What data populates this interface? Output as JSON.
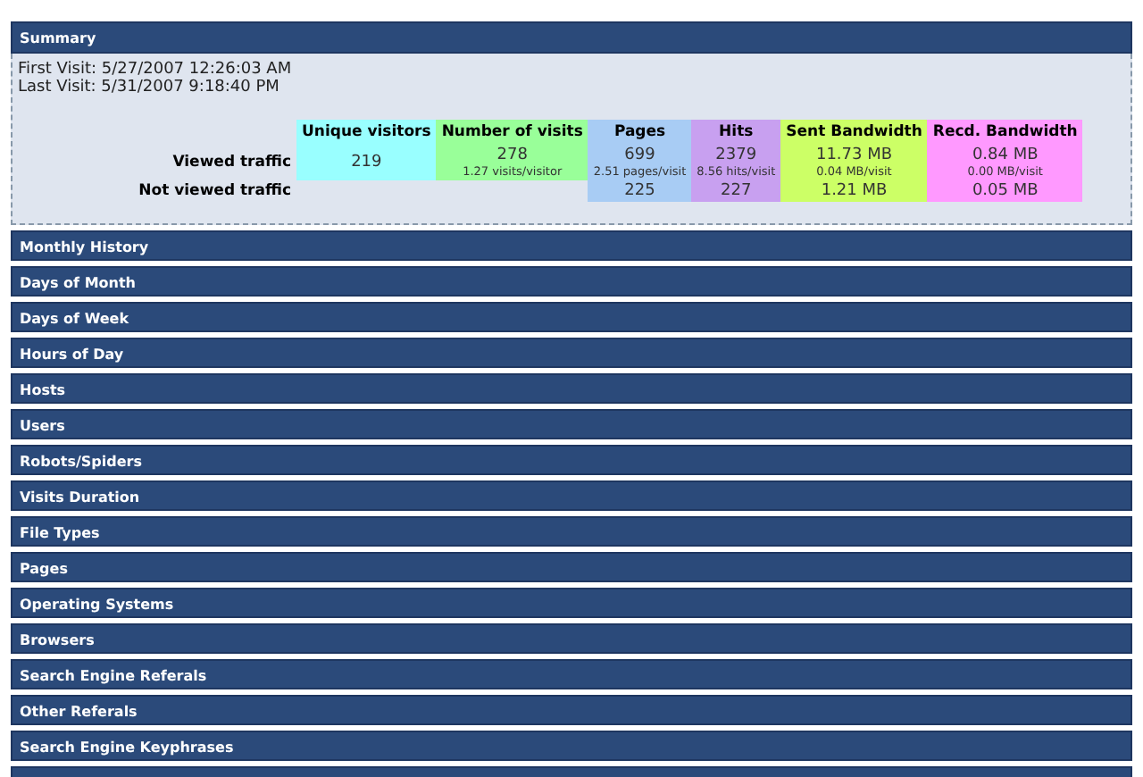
{
  "summary": {
    "title": "Summary",
    "first_visit": "First Visit: 5/27/2007 12:26:03 AM",
    "last_visit": "Last Visit: 5/31/2007 9:18:40 PM",
    "columns": [
      {
        "label": "Unique visitors",
        "color": "#99ffff"
      },
      {
        "label": "Number of visits",
        "color": "#99ff99"
      },
      {
        "label": "Pages",
        "color": "#a8ccf4"
      },
      {
        "label": "Hits",
        "color": "#c8a0f0"
      },
      {
        "label": "Sent Bandwidth",
        "color": "#ccff66"
      },
      {
        "label": "Recd. Bandwidth",
        "color": "#ff99ff"
      }
    ],
    "rows": [
      {
        "label": "Viewed traffic",
        "cells": [
          {
            "value": "219"
          },
          {
            "value": "278",
            "detail": "1.27 visits/visitor"
          },
          {
            "value": "699",
            "detail": "2.51 pages/visit"
          },
          {
            "value": "2379",
            "detail": "8.56 hits/visit"
          },
          {
            "value": "11.73 MB",
            "detail": "0.04 MB/visit"
          },
          {
            "value": "0.84 MB",
            "detail": "0.00 MB/visit"
          }
        ]
      },
      {
        "label": "Not viewed traffic",
        "cells": [
          null,
          null,
          {
            "value": "225"
          },
          {
            "value": "227"
          },
          {
            "value": "1.21 MB"
          },
          {
            "value": "0.05 MB"
          }
        ]
      }
    ]
  },
  "sections": [
    {
      "title": "Monthly History"
    },
    {
      "title": "Days of Month"
    },
    {
      "title": "Days of Week"
    },
    {
      "title": "Hours of Day"
    },
    {
      "title": "Hosts"
    },
    {
      "title": "Users"
    },
    {
      "title": "Robots/Spiders"
    },
    {
      "title": "Visits Duration"
    },
    {
      "title": "File Types"
    },
    {
      "title": "Pages"
    },
    {
      "title": "Operating Systems"
    },
    {
      "title": "Browsers"
    },
    {
      "title": "Search Engine Referals"
    },
    {
      "title": "Other Referals"
    },
    {
      "title": "Search Engine Keyphrases"
    }
  ]
}
